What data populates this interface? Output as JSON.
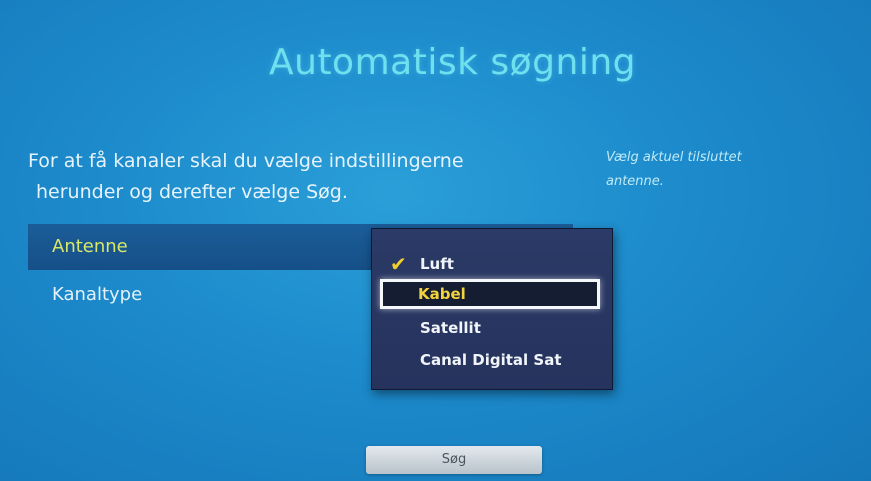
{
  "screen": {
    "title": "Automatisk søgning",
    "instruction_line1": "For at få kanaler skal du vælge indstillingerne",
    "instruction_line2": "herunder og derefter vælge Søg.",
    "help_line1": "Vælg aktuel tilsluttet",
    "help_line2": "antenne."
  },
  "settings": {
    "antenna_label": "Antenne",
    "channel_type_label": "Kanaltype"
  },
  "dropdown": {
    "selected": "Luft",
    "highlighted": "Kabel",
    "options": [
      "Luft",
      "Kabel",
      "Satellit",
      "Canal Digital Sat"
    ]
  },
  "buttons": {
    "search_label": "Søg"
  },
  "colors": {
    "background": "#1c8acb",
    "title": "#6fe0ee",
    "highlight_text": "#f3d33c",
    "checkmark": "#f2cf2e"
  },
  "icons": {
    "selected_marker": "checkmark-icon"
  }
}
